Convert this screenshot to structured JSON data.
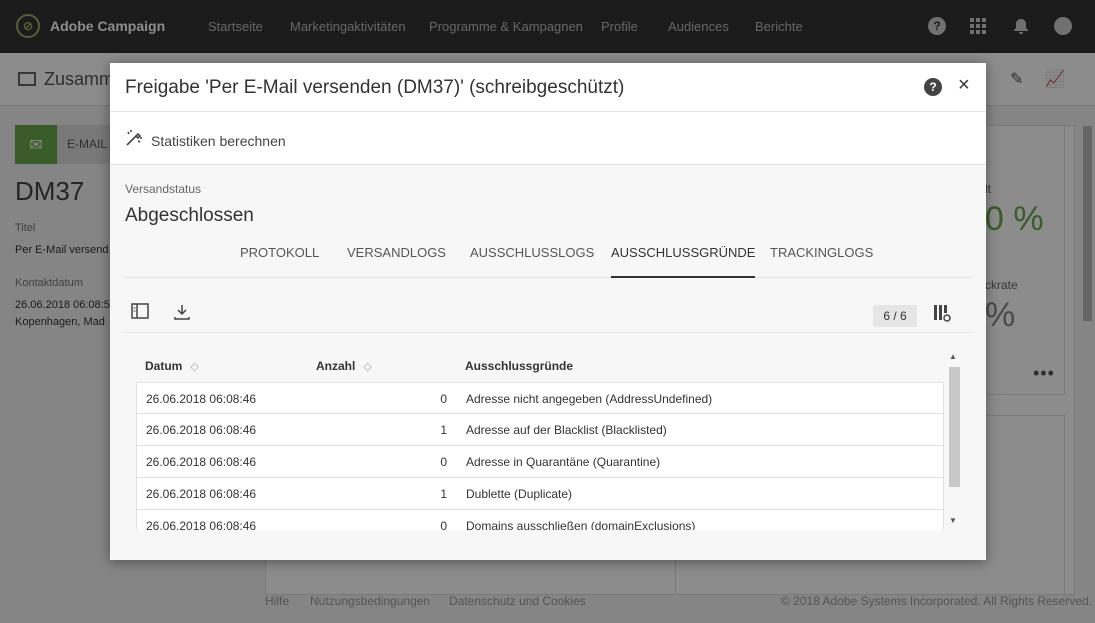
{
  "topnav": {
    "app_name": "Adobe Campaign",
    "items": [
      "Startseite",
      "Marketingaktivitäten",
      "Programme & Kampagnen",
      "Profile",
      "Audiences",
      "Berichte"
    ],
    "icons": [
      "help-icon",
      "apps-grid-icon",
      "bell-icon",
      "user-avatar-icon"
    ]
  },
  "background": {
    "page_title": "Zusamm",
    "channel_type": "E-MAIL",
    "delivery_id": "DM37",
    "title_label": "Titel",
    "title_value": "Per E-Mail versend",
    "contact_date_label": "Kontaktdatum",
    "contact_date_value": "26.06.2018 06:08:5",
    "contact_location": "Kopenhagen, Mad",
    "stat1_label": "lt",
    "stat1_value": "0 %",
    "stat2_label": "ckrate",
    "stat2_value": "%",
    "footer": {
      "links": [
        "Hilfe",
        "Nutzungsbedingungen",
        "Datenschutz und Cookies"
      ],
      "copyright": "© 2018 Adobe Systems Incorporated. All Rights Reserved."
    }
  },
  "modal": {
    "title": "Freigabe 'Per E-Mail versenden (DM37)' (schreibgeschützt)",
    "help_icon": "?",
    "close_icon": "×",
    "compute_stats_label": "Statistiken berechnen",
    "status_label": "Versandstatus",
    "status_value": "Abgeschlossen",
    "tabs": [
      {
        "label": "PROTOKOLL",
        "active": false
      },
      {
        "label": "VERSANDLOGS",
        "active": false
      },
      {
        "label": "AUSSCHLUSSLOGS",
        "active": false
      },
      {
        "label": "AUSSCHLUSSGRÜNDE",
        "active": true
      },
      {
        "label": "TRACKINGLOGS",
        "active": false
      }
    ],
    "record_count": "6 / 6",
    "table": {
      "columns": [
        "Datum",
        "Anzahl",
        "Ausschlussgründe"
      ],
      "rows": [
        {
          "date": "26.06.2018 06:08:46",
          "count": "0",
          "reason": "Adresse nicht angegeben (AddressUndefined)"
        },
        {
          "date": "26.06.2018 06:08:46",
          "count": "1",
          "reason": "Adresse auf der Blacklist (Blacklisted)"
        },
        {
          "date": "26.06.2018 06:08:46",
          "count": "0",
          "reason": "Adresse in Quarantäne (Quarantine)"
        },
        {
          "date": "26.06.2018 06:08:46",
          "count": "1",
          "reason": "Dublette (Duplicate)"
        },
        {
          "date": "26.06.2018 06:08:46",
          "count": "0",
          "reason": "Domains ausschließen (domainExclusions)"
        }
      ]
    }
  }
}
